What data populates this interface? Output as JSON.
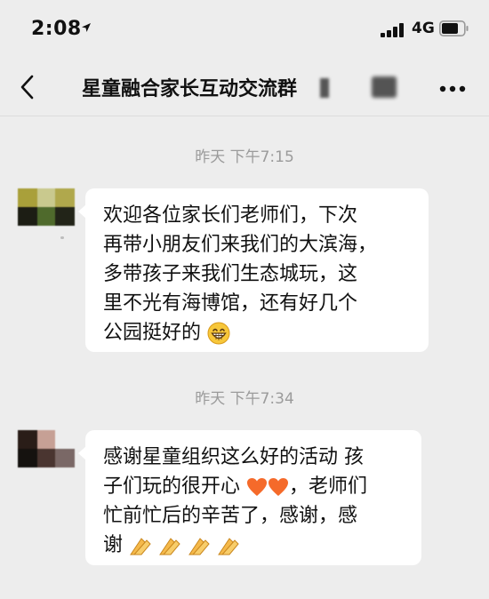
{
  "status_bar": {
    "time": "2:08",
    "network": "4G"
  },
  "header": {
    "back_icon": "chevron-left-icon",
    "title": "星童融合家长互动交流群",
    "more_icon": "more-dots-icon"
  },
  "messages": [
    {
      "timestamp": "昨天 下午7:15",
      "lines": [
        "欢迎各位家长们老师们，下次",
        "再带小朋友们来我们的大滨海，",
        "多带孩子来我们生态城玩，这",
        "里不光有海博馆，还有好几个",
        "公园挺好的"
      ],
      "emoji": "grinning-face-icon"
    },
    {
      "timestamp": "昨天 下午7:34",
      "lines": [
        "感谢星童组织这么好的活动 孩",
        "子们玩的很开心",
        "，老师们",
        "忙前忙后的辛苦了，感谢，感",
        "谢"
      ],
      "emojis_line2": "orange-heart-icon",
      "emojis_line4": "folded-hands-icon"
    }
  ],
  "colors": {
    "background": "#ededed",
    "bubble": "#ffffff",
    "timestamp": "#9b9b9b",
    "heart": "#f56a2a",
    "hands": "#f5b94a"
  }
}
